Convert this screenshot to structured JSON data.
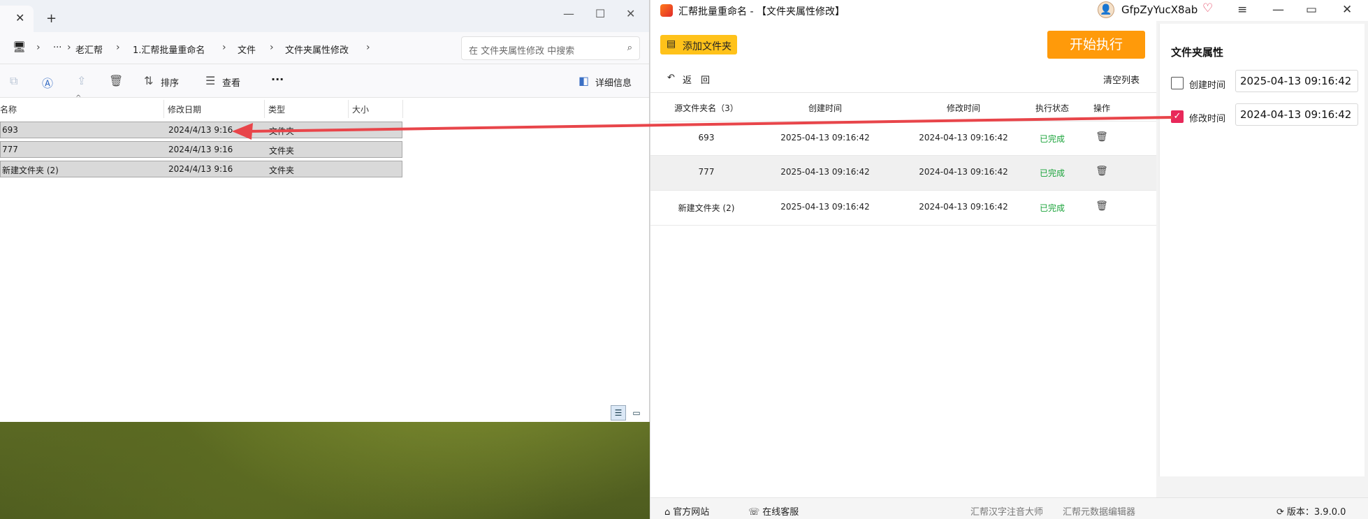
{
  "explorer": {
    "tab_close": "✕",
    "new_tab": "+",
    "controls": {
      "minimize": "—",
      "maximize": "☐",
      "close": "✕"
    },
    "breadcrumb": {
      "more": "···",
      "items": [
        "老汇帮",
        "1.汇帮批量重命名",
        "文件",
        "文件夹属性修改"
      ]
    },
    "search_placeholder": "在 文件夹属性修改 中搜索",
    "toolbar": {
      "sort": "排序",
      "view": "查看",
      "more": "···",
      "details": "详细信息"
    },
    "columns": {
      "name": "名称",
      "modified": "修改日期",
      "type": "类型",
      "size": "大小"
    },
    "rows": [
      {
        "name": "693",
        "modified": "2024/4/13 9:16",
        "type": "文件夹"
      },
      {
        "name": "777",
        "modified": "2024/4/13 9:16",
        "type": "文件夹"
      },
      {
        "name": "新建文件夹 (2)",
        "modified": "2024/4/13 9:16",
        "type": "文件夹"
      }
    ]
  },
  "app": {
    "title": "汇帮批量重命名 - 【文件夹属性修改】",
    "username": "GfpZyYucX8ab",
    "add_folder": "添加文件夹",
    "start": "开始执行",
    "back": "返　回",
    "clear_list": "清空列表",
    "table": {
      "headers": {
        "name": "源文件夹名（3）",
        "created": "创建时间",
        "modified": "修改时间",
        "status": "执行状态",
        "action": "操作"
      },
      "rows": [
        {
          "name": "693",
          "created": "2025-04-13 09:16:42",
          "modified": "2024-04-13 09:16:42",
          "status": "已完成"
        },
        {
          "name": "777",
          "created": "2025-04-13 09:16:42",
          "modified": "2024-04-13 09:16:42",
          "status": "已完成"
        },
        {
          "name": "新建文件夹 (2)",
          "created": "2025-04-13 09:16:42",
          "modified": "2024-04-13 09:16:42",
          "status": "已完成"
        }
      ]
    },
    "props": {
      "title": "文件夹属性",
      "created_label": "创建时间",
      "created_value": "2025-04-13 09:16:42",
      "created_checked": false,
      "modified_label": "修改时间",
      "modified_value": "2024-04-13 09:16:42",
      "modified_checked": true
    },
    "footer": {
      "website": "官方网站",
      "support": "在线客服",
      "link1": "汇帮汉字注音大师",
      "link2": "汇帮元数据编辑器",
      "version": "版本：3.9.0.0"
    },
    "colors": {
      "accent": "#ff9a0a",
      "add_button": "#ffc21a",
      "done": "#1aa33a",
      "checkbox": "#e8285a",
      "arrow": "#e8454a"
    }
  }
}
